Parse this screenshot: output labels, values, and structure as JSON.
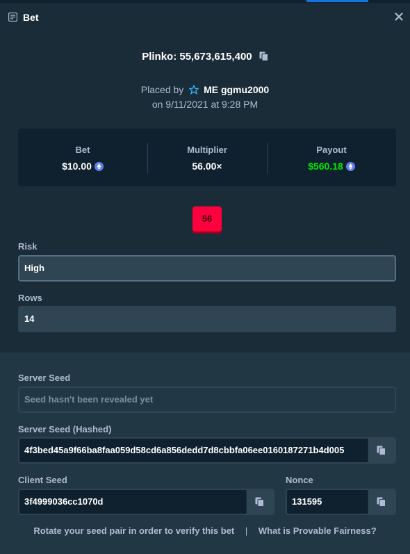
{
  "header": {
    "title": "Bet"
  },
  "game": {
    "label": "Plinko: 55,673,615,400"
  },
  "placed": {
    "prefix": "Placed by",
    "username": "ME ggmu2000",
    "date": "on 9/11/2021 at 9:28 PM"
  },
  "stats": {
    "bet_label": "Bet",
    "bet_value": "$10.00",
    "multiplier_label": "Multiplier",
    "multiplier_value": "56.00×",
    "payout_label": "Payout",
    "payout_value": "$560.18"
  },
  "result_badge": "56",
  "risk": {
    "label": "Risk",
    "value": "High"
  },
  "rows": {
    "label": "Rows",
    "value": "14"
  },
  "server_seed": {
    "label": "Server Seed",
    "value": "Seed hasn't been revealed yet"
  },
  "server_seed_hashed": {
    "label": "Server Seed (Hashed)",
    "value": "4f3bed45a9f66ba8faa059d58cd6a856dedd7d8cbbfa06ee0160187271b4d005"
  },
  "client_seed": {
    "label": "Client Seed",
    "value": "3f4999036cc1070d"
  },
  "nonce": {
    "label": "Nonce",
    "value": "131595"
  },
  "footer": {
    "rotate_text": "Rotate your seed pair in order to verify this bet",
    "separator": "|",
    "fairness_text": "What is Provable Fairness?"
  },
  "colors": {
    "background": "#1a2c38",
    "panel": "#0f212e",
    "payout": "#00e701",
    "badge": "#ff003f",
    "accent": "#1475e1"
  },
  "icons": [
    "bet-icon",
    "close-icon",
    "copy-icon",
    "star-icon",
    "eth-icon"
  ]
}
